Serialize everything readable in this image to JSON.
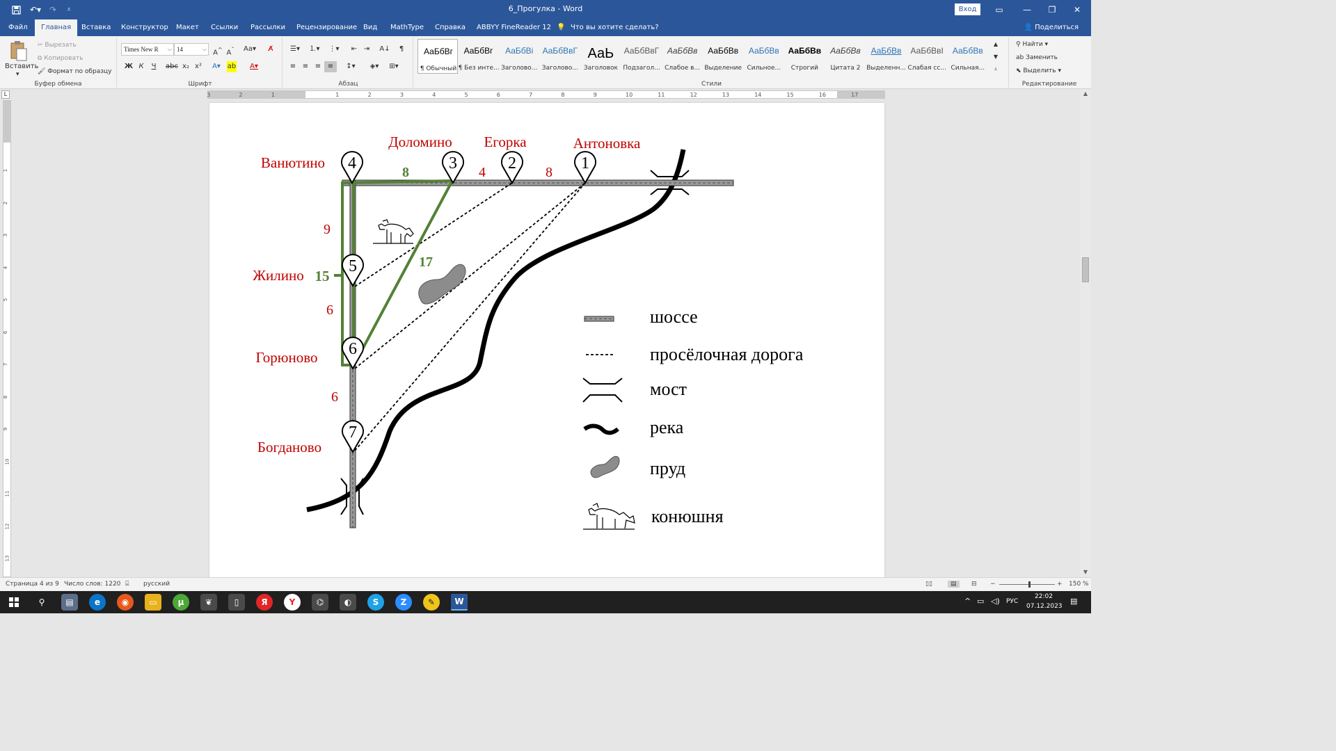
{
  "titlebar": {
    "document_title": "6_Прогулка - Word",
    "sign_in": "Вход"
  },
  "tabs": [
    "Файл",
    "Главная",
    "Вставка",
    "Конструктор",
    "Макет",
    "Ссылки",
    "Рассылки",
    "Рецензирование",
    "Вид",
    "MathType",
    "Справка",
    "ABBYY FineReader 12"
  ],
  "tell_me": "Что вы хотите сделать?",
  "share_label": "Поделиться",
  "clipboard": {
    "paste": "Вставить",
    "cut": "Вырезать",
    "copy": "Копировать",
    "format_painter": "Формат по образцу",
    "label": "Буфер обмена"
  },
  "font": {
    "name": "Times New R",
    "size": "14",
    "label": "Шрифт",
    "bold": "Ж",
    "italic": "К",
    "underline": "Ч"
  },
  "paragraph": {
    "label": "Абзац"
  },
  "styles": {
    "label": "Стили",
    "items": [
      {
        "sample": "АаБбВг",
        "name": "¶ Обычный",
        "color": "#000000"
      },
      {
        "sample": "АаБбВг",
        "name": "¶ Без инте...",
        "color": "#000000"
      },
      {
        "sample": "АаБбВі",
        "name": "Заголово...",
        "color": "#2e74b5"
      },
      {
        "sample": "АаБбВвГ",
        "name": "Заголово...",
        "color": "#2e74b5"
      },
      {
        "sample": "АаЬ",
        "name": "Заголовок",
        "color": "#000000"
      },
      {
        "sample": "АаБбВвГ",
        "name": "Подзагол...",
        "color": "#595959"
      },
      {
        "sample": "АаБбВв",
        "name": "Слабое в...",
        "color": "#404040"
      },
      {
        "sample": "АаБбВв",
        "name": "Выделение",
        "color": "#000000"
      },
      {
        "sample": "АаБбВв",
        "name": "Сильное...",
        "color": "#2e74b5"
      },
      {
        "sample": "АаБбВв",
        "name": "Строгий",
        "color": "#000000"
      },
      {
        "sample": "АаБбВв",
        "name": "Цитата 2",
        "color": "#404040"
      },
      {
        "sample": "АаБбВв",
        "name": "Выделенн...",
        "color": "#2e74b5"
      },
      {
        "sample": "АаБбВвІ",
        "name": "Слабая сс...",
        "color": "#595959"
      },
      {
        "sample": "АаБбВв",
        "name": "Сильная...",
        "color": "#2e74b5"
      }
    ]
  },
  "editing": {
    "find": "Найти",
    "replace": "Заменить",
    "select": "Выделить",
    "label": "Редактирование"
  },
  "ruler": {
    "ticks": [
      "3",
      "2",
      "1",
      "1",
      "2",
      "3",
      "4",
      "5",
      "6",
      "7",
      "8",
      "9",
      "10",
      "11",
      "12",
      "13",
      "14",
      "15",
      "16",
      "17"
    ]
  },
  "vruler_ticks": [
    "1",
    "2",
    "3",
    "4",
    "5",
    "6",
    "7",
    "8",
    "9",
    "10",
    "11",
    "12",
    "13"
  ],
  "map": {
    "villages": {
      "vanyutino": "Ванютино",
      "dolomino": "Доломино",
      "egorka": "Егорка",
      "antonovka": "Антоновка",
      "zhilino": "Жилино",
      "goryunovo": "Горюново",
      "bogdanovo": "Богданово"
    },
    "markers": {
      "vanyutino": "4",
      "dolomino": "3",
      "egorka": "2",
      "antonovka": "1",
      "zhilino": "5",
      "goryunovo": "6",
      "bogdanovo": "7"
    },
    "distances": {
      "d3_2": "4",
      "d2_1": "8",
      "d4_5": "9",
      "d5_6": "6",
      "d6_7": "6"
    },
    "route_labels": {
      "d4_3": "8",
      "d3_6": "17",
      "d4_6": "15"
    },
    "colors": {
      "route": "#538135",
      "labels": "#c00000",
      "road": "#909090",
      "pond": "#8c8c8c"
    },
    "legend": {
      "highway": "шоссе",
      "dirt_road": "просёлочная дорога",
      "bridge": "мост",
      "river": "река",
      "pond": "пруд",
      "stable": "конюшня"
    }
  },
  "status": {
    "page": "Страница 4 из 9",
    "words": "Число слов: 1220",
    "language": "русский",
    "zoom": "150 %"
  },
  "taskbar": {
    "language": "РУС",
    "time": "22:02",
    "date": "07.12.2023"
  }
}
